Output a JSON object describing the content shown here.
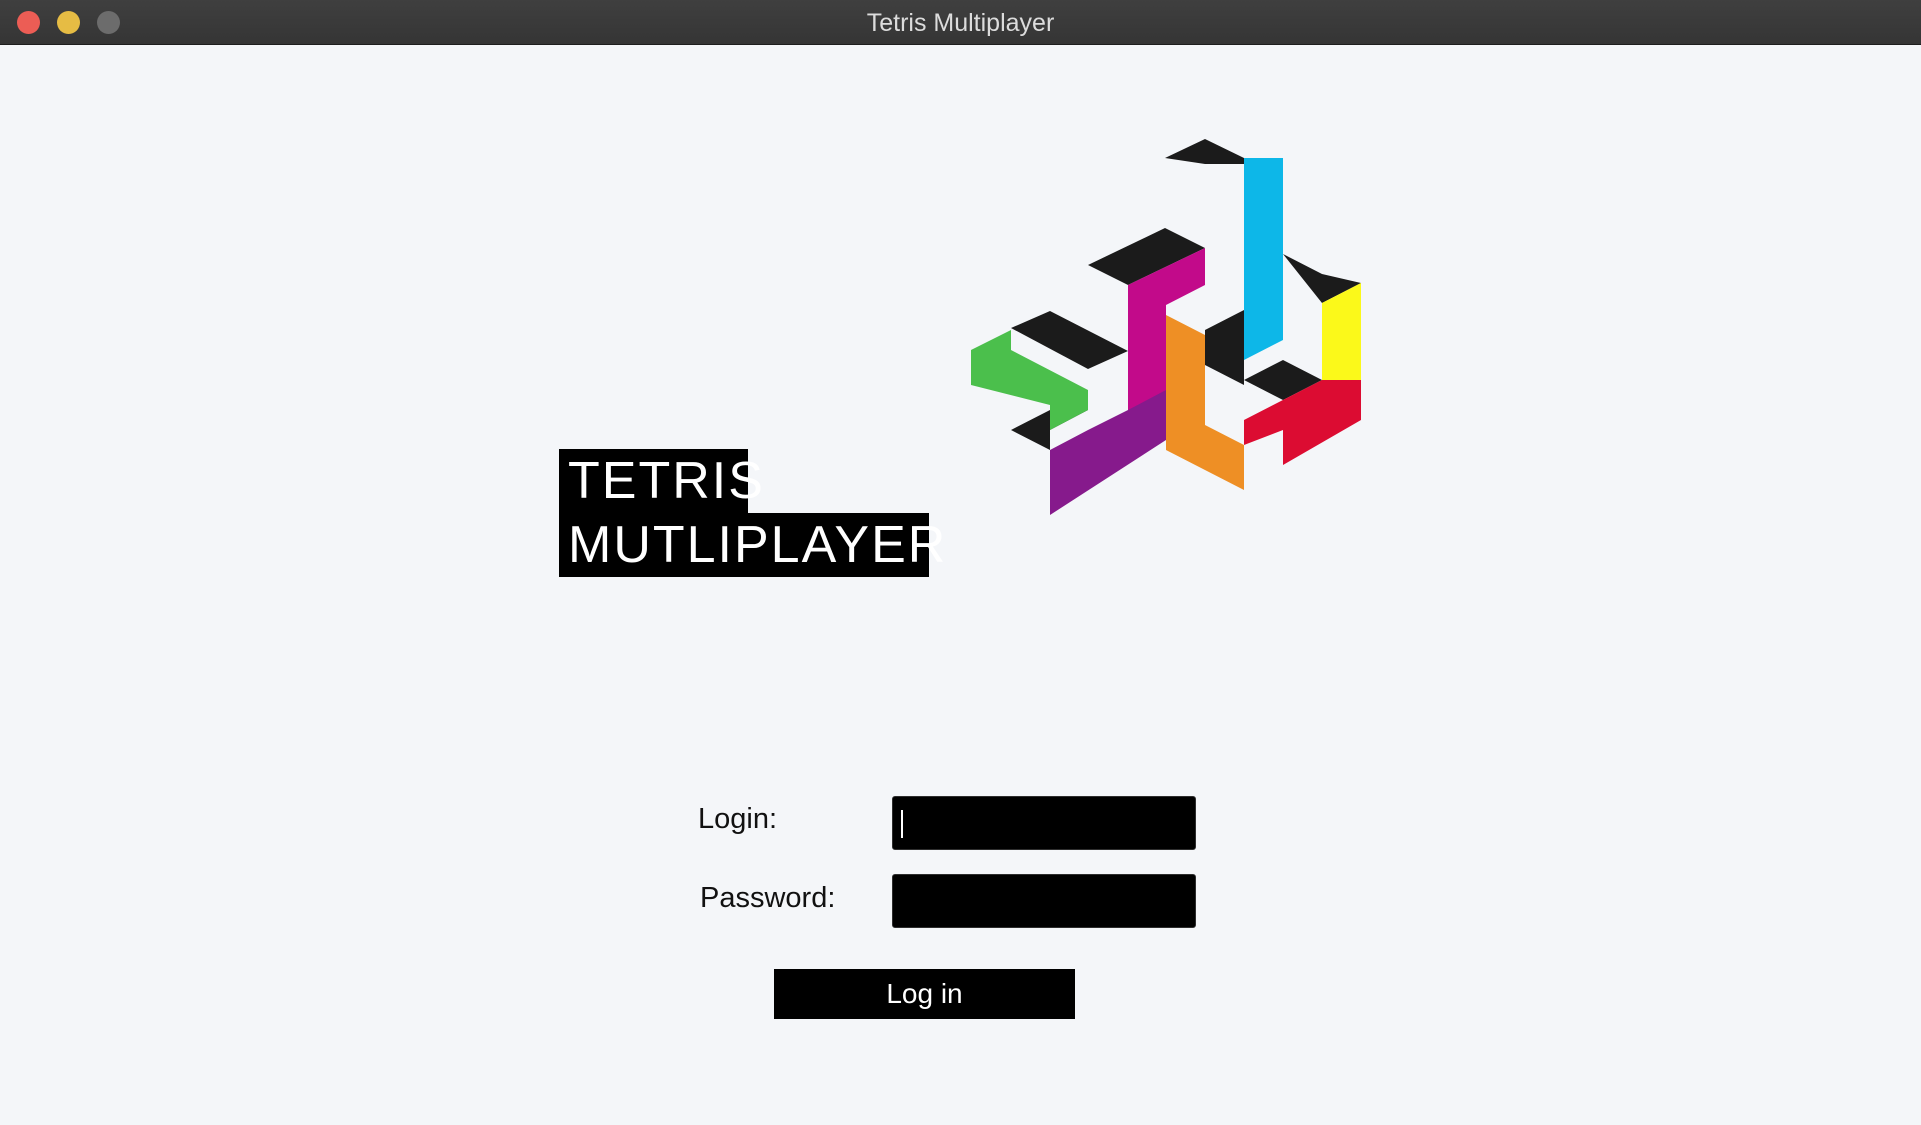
{
  "window": {
    "title": "Tetris Multiplayer"
  },
  "logo": {
    "line1": "TETRIS",
    "line2": "MUTLIPLAYER",
    "icon": "tetris-blocks-logo"
  },
  "form": {
    "login_label": "Login:",
    "login_value": "",
    "password_label": "Password:",
    "password_value": "",
    "submit_label": "Log in"
  },
  "colors": {
    "background": "#f4f6f9",
    "titlebar": "#3a3a3a",
    "field": "#000000",
    "button": "#000000",
    "block_black": "#1b1b1b",
    "block_cyan": "#0db7e8",
    "block_magenta": "#c20a8a",
    "block_green": "#4bbf4c",
    "block_orange": "#ee8f25",
    "block_yellow": "#fbf91a",
    "block_red": "#dc0c32",
    "block_purple": "#861a8c"
  }
}
